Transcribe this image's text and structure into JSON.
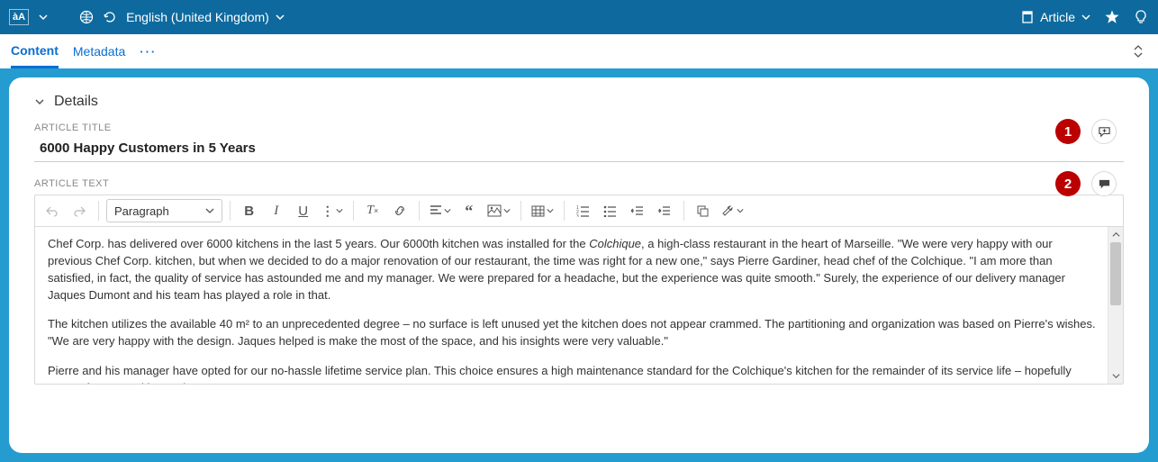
{
  "topbar": {
    "language": "English (United Kingdom)",
    "right_label": "Article"
  },
  "tabs": {
    "content": "Content",
    "metadata": "Metadata"
  },
  "details": {
    "heading": "Details"
  },
  "fields": {
    "title_label": "ARTICLE TITLE",
    "title_value": "6000 Happy Customers in 5 Years",
    "text_label": "ARTICLE TEXT"
  },
  "badges": {
    "b1": "1",
    "b2": "2"
  },
  "editor": {
    "style": "Paragraph",
    "body_p1_a": "Chef Corp. has delivered over 6000 kitchens in the last 5 years. Our 6000th kitchen was installed for the ",
    "body_p1_em": "Colchique",
    "body_p1_b": ", a high-class restaurant in the heart of Marseille. \"We were very happy with our previous Chef Corp. kitchen, but when we decided to do a major renovation of our restaurant, the time was right for a new one,\" says Pierre Gardiner, head chef of the Colchique. \"I am more than satisfied, in fact, the quality of service has astounded me and my manager. We were prepared for a headache, but the experience was quite smooth.\" Surely, the experience of our delivery manager Jaques Dumont and his team has played a role in that.",
    "body_p2": "The kitchen utilizes the available 40 m² to an unprecedented degree – no surface is left unused yet the kitchen does not appear crammed. The partitioning and organization was based on Pierre's wishes. \"We are very happy with the design. Jaques helped is make the most of the space, and his insights were very valuable.\"",
    "body_p3": "Pierre and his manager have opted for our no-hassle lifetime service plan. This choice ensures a high maintenance standard for the Colchique's kitchen for the remainder of its service life – hopefully years of great cooking and"
  }
}
